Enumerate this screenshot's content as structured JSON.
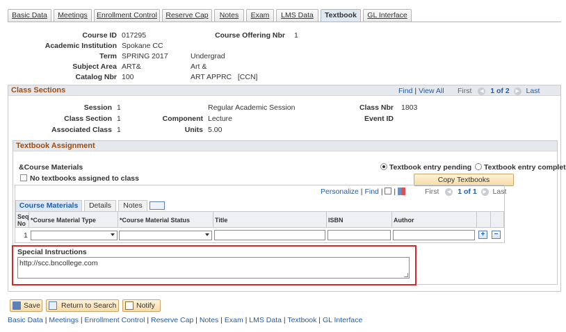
{
  "tabs": [
    {
      "label": "Basic Data",
      "active": false
    },
    {
      "label": "Meetings",
      "active": false
    },
    {
      "label": "Enrollment Control",
      "active": false
    },
    {
      "label": "Reserve Cap",
      "active": false
    },
    {
      "label": "Notes",
      "active": false
    },
    {
      "label": "Exam",
      "active": false
    },
    {
      "label": "LMS Data",
      "active": false
    },
    {
      "label": "Textbook",
      "active": true
    },
    {
      "label": "GL Interface",
      "active": false
    }
  ],
  "course": {
    "course_id_label": "Course ID",
    "course_id": "017295",
    "offering_label": "Course Offering Nbr",
    "offering": "1",
    "institution_label": "Academic Institution",
    "institution": "Spokane CC",
    "term_label": "Term",
    "term": "SPRING 2017",
    "career": "Undergrad",
    "subject_label": "Subject Area",
    "subject": "ART&",
    "subject_desc": "Art &",
    "catalog_label": "Catalog Nbr",
    "catalog": "100",
    "catalog_desc": "ART APPRC   [CCN]"
  },
  "class_sections": {
    "title": "Class Sections",
    "find": "Find",
    "sep": "|",
    "view_all": "View All",
    "first": "First",
    "count": "1 of 2",
    "last": "Last",
    "session_label": "Session",
    "session": "1",
    "session_desc": "Regular Academic Session",
    "class_nbr_label": "Class Nbr",
    "class_nbr": "1803",
    "section_label": "Class Section",
    "section": "1",
    "component_label": "Component",
    "component": "Lecture",
    "event_label": "Event ID",
    "event": "",
    "assoc_label": "Associated Class",
    "assoc": "1",
    "units_label": "Units",
    "units": "5.00"
  },
  "textbook": {
    "title": "Textbook Assignment",
    "materials_label": "&Course Materials",
    "no_textbooks": "No textbooks assigned to class",
    "radio_pending": "Textbook entry pending",
    "radio_complete": "Textbook entry complete",
    "copy_button": "Copy Textbooks",
    "personalize": "Personalize",
    "find": "Find",
    "first": "First",
    "count": "1 of 1",
    "last": "Last",
    "subtabs": [
      "Course Materials",
      "Details",
      "Notes"
    ],
    "columns": {
      "seq": "Seq No",
      "type": "*Course Material Type",
      "status": "*Course Material Status",
      "title": "Title",
      "isbn": "ISBN",
      "author": "Author"
    },
    "row_seq": "1",
    "add": "+",
    "remove": "−"
  },
  "special": {
    "label": "Special Instructions",
    "value": "http://scc.bncollege.com"
  },
  "buttons": {
    "save": "Save",
    "return": "Return to Search",
    "notify": "Notify"
  },
  "footer_links": [
    "Basic Data",
    "Meetings",
    "Enrollment Control",
    "Reserve Cap",
    "Notes",
    "Exam",
    "LMS Data",
    "Textbook",
    "GL Interface"
  ],
  "colors": {
    "header_text": "#994d15",
    "link": "#1f5da8",
    "highlight_border": "#d9262b"
  }
}
